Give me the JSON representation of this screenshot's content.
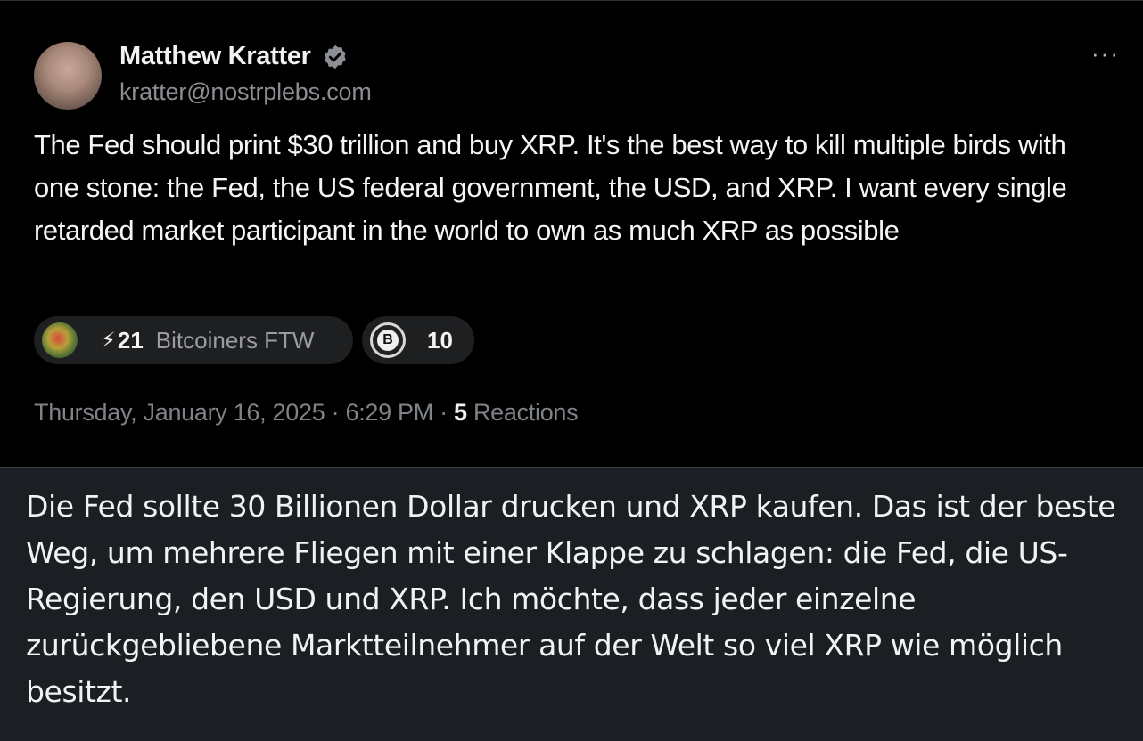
{
  "post": {
    "author": {
      "name": "Matthew Kratter",
      "handle": "kratter@nostrplebs.com",
      "verified_icon": "verified-badge-icon",
      "avatar_icon": "user-avatar"
    },
    "more_label": "···",
    "text": "The Fed should print $30 trillion and buy XRP. It's the best way to kill multiple birds with one stone: the Fed, the US federal government, the USD, and XRP. I want every single retarded market participant in the world to own as much XRP as possible",
    "zap_chip": {
      "icon": "zapper-avatar",
      "bolt": "⚡",
      "count": "21",
      "name": "Bitcoiners FTW"
    },
    "badge_chip": {
      "icon": "bitcoin-badge-icon",
      "symbol": "B",
      "count": "10"
    },
    "meta": {
      "date_time": "Thursday, January 16, 2025 · 6:29 PM · ",
      "reactions_count": "5",
      "reactions_label": " Reactions"
    }
  },
  "translation": {
    "text": "Die Fed sollte 30 Billionen Dollar drucken und XRP kaufen. Das ist der beste Weg, um mehrere Fliegen mit einer Klappe zu schlagen: die Fed, die US-Regierung, den USD und XRP. Ich möchte, dass jeder einzelne zurückgebliebene Marktteilnehmer auf der Welt so viel XRP wie möglich besitzt."
  },
  "colors": {
    "post_background": "#000000",
    "translation_background": "#1b1f24",
    "primary_text": "#f5f5f5",
    "secondary_text": "#8a8d91"
  }
}
